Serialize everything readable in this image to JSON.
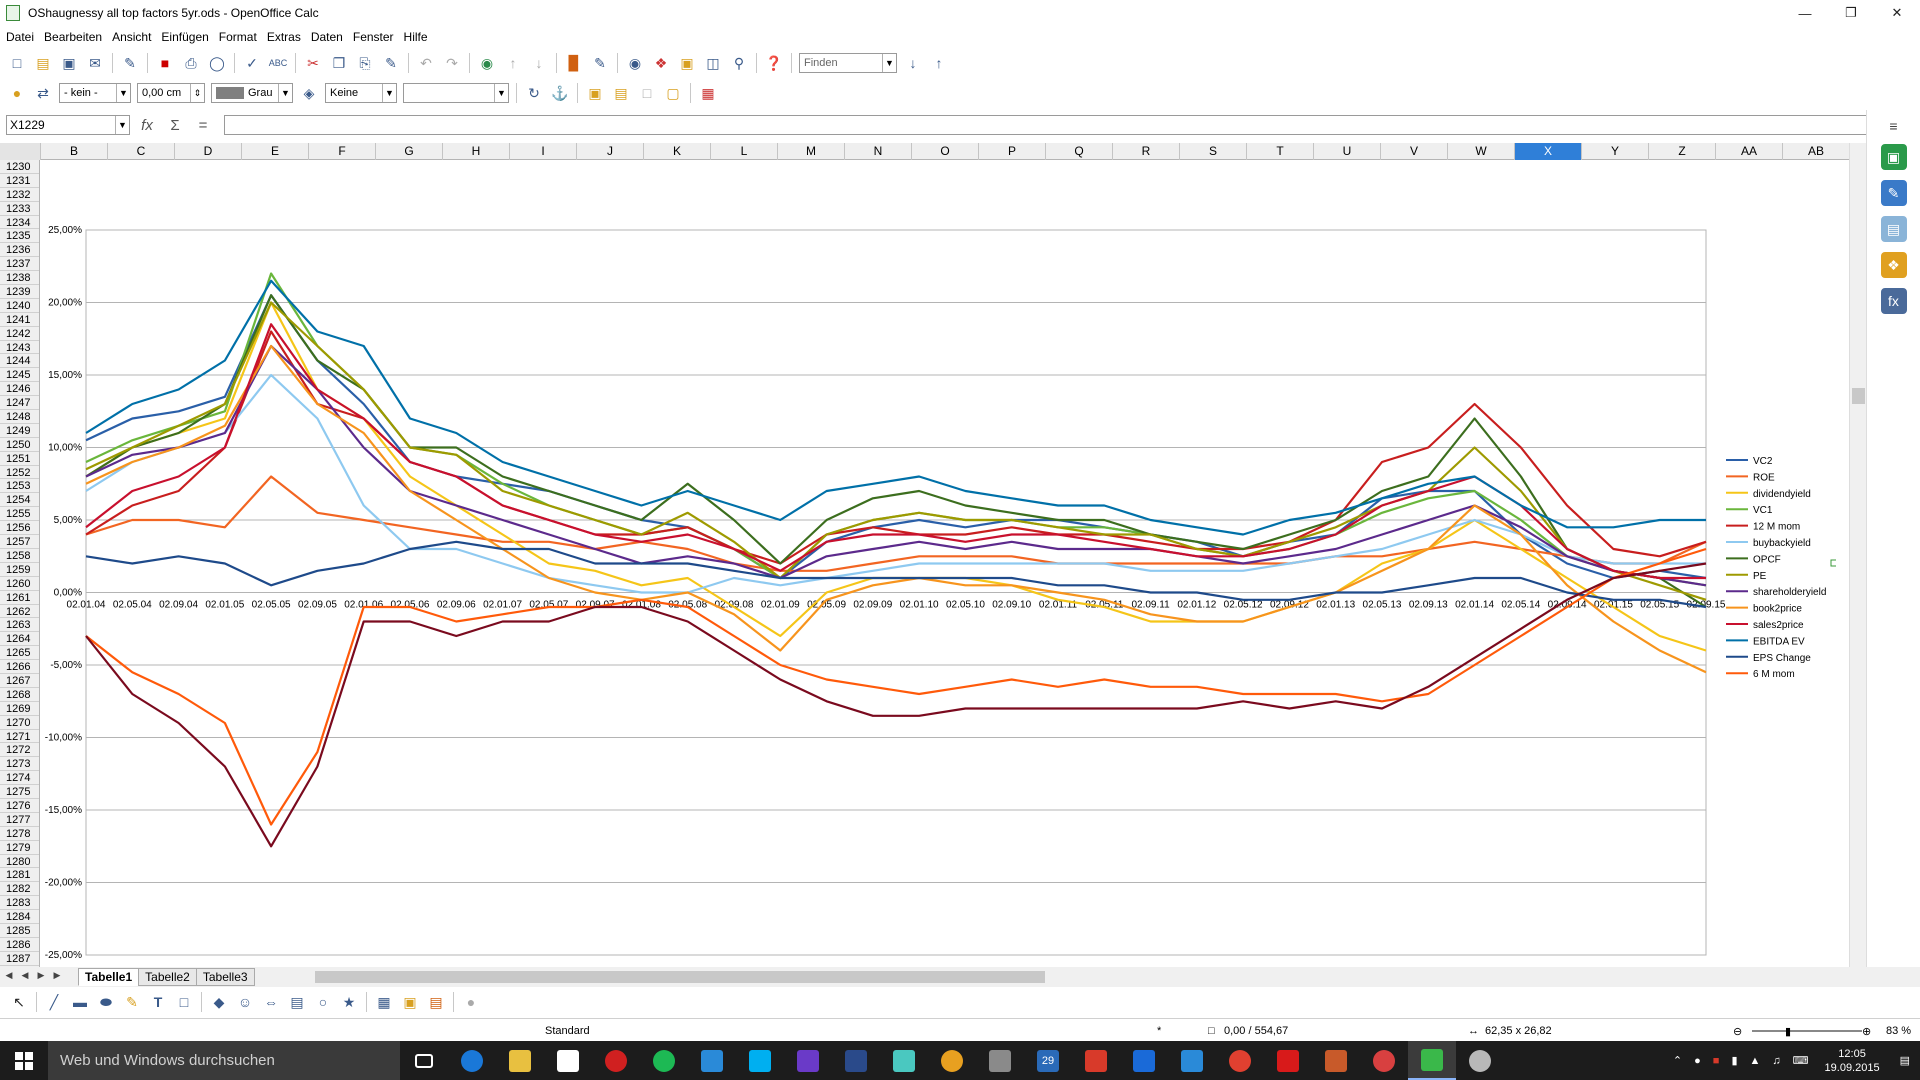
{
  "window": {
    "title": "OShaugnessy all top factors 5yr.ods - OpenOffice Calc"
  },
  "menu": [
    "Datei",
    "Bearbeiten",
    "Ansicht",
    "Einfügen",
    "Format",
    "Extras",
    "Daten",
    "Fenster",
    "Hilfe"
  ],
  "toolbar1": {
    "find_placeholder": "Finden"
  },
  "toolbar2": {
    "line_style": "- kein -",
    "line_width": "0,00 cm",
    "line_color": "Grau",
    "area_style": "Keine",
    "area_fill": ""
  },
  "formula": {
    "cell_ref": "X1229",
    "content": ""
  },
  "columns": [
    "B",
    "C",
    "D",
    "E",
    "F",
    "G",
    "H",
    "I",
    "J",
    "K",
    "L",
    "M",
    "N",
    "O",
    "P",
    "Q",
    "R",
    "S",
    "T",
    "U",
    "V",
    "W",
    "X",
    "Y",
    "Z",
    "AA",
    "AB"
  ],
  "selected_column": "X",
  "rows": [
    "1230",
    "1231",
    "1232",
    "1233",
    "1234",
    "1235",
    "1236",
    "1237",
    "1238",
    "1239",
    "1240",
    "1241",
    "1242",
    "1243",
    "1244",
    "1245",
    "1246",
    "1247",
    "1248",
    "1249",
    "1250",
    "1251",
    "1252",
    "1253",
    "1254",
    "1255",
    "1256",
    "1257",
    "1258",
    "1259",
    "1260",
    "1261",
    "1262",
    "1263",
    "1264",
    "1265",
    "1266",
    "1267",
    "1268",
    "1269",
    "1270",
    "1271",
    "1272",
    "1273",
    "1274",
    "1275",
    "1276",
    "1277",
    "1278",
    "1279",
    "1280",
    "1281",
    "1282",
    "1283",
    "1284",
    "1285",
    "1286",
    "1287"
  ],
  "sheet_tabs": [
    "Tabelle1",
    "Tabelle2",
    "Tabelle3"
  ],
  "active_tab": "Tabelle1",
  "status": {
    "style": "Standard",
    "mode": "*",
    "position": "0,00 / 554,67",
    "size": "62,35 x 26,82",
    "zoom": "83 %"
  },
  "taskbar": {
    "search_placeholder": "Web und Windows durchsuchen",
    "time": "12:05",
    "date": "19.09.2015",
    "calendar_day": "29"
  },
  "colors": {
    "selection": "#2f7fd8",
    "taskbar": "#1c1c1c"
  },
  "chart_data": {
    "type": "line",
    "title": "",
    "xlabel": "",
    "ylabel": "",
    "ylim": [
      -0.25,
      0.25
    ],
    "yticks": [
      "25,00%",
      "20,00%",
      "15,00%",
      "10,00%",
      "5,00%",
      "0,00%",
      "-5,00%",
      "-10,00%",
      "-15,00%",
      "-20,00%",
      "-25,00%"
    ],
    "grid": true,
    "legend_position": "right",
    "x": [
      "02.01.04",
      "02.05.04",
      "02.09.04",
      "02.01.05",
      "02.05.05",
      "02.09.05",
      "02.01.06",
      "02.05.06",
      "02.09.06",
      "02.01.07",
      "02.05.07",
      "02.09.07",
      "02.01.08",
      "02.05.08",
      "02.09.08",
      "02.01.09",
      "02.05.09",
      "02.09.09",
      "02.01.10",
      "02.05.10",
      "02.09.10",
      "02.01.11",
      "02.05.11",
      "02.09.11",
      "02.01.12",
      "02.05.12",
      "02.09.12",
      "02.01.13",
      "02.05.13",
      "02.09.13",
      "02.01.14",
      "02.05.14",
      "02.09.14",
      "02.01.15",
      "02.05.15",
      "02.09.15"
    ],
    "series": [
      {
        "name": "VC2",
        "color": "#2a5fa8",
        "values": [
          0.105,
          0.12,
          0.125,
          0.135,
          0.205,
          0.16,
          0.13,
          0.09,
          0.08,
          0.075,
          0.07,
          0.06,
          0.05,
          0.045,
          0.03,
          0.01,
          0.035,
          0.045,
          0.05,
          0.045,
          0.05,
          0.05,
          0.045,
          0.04,
          0.035,
          0.025,
          0.035,
          0.04,
          0.065,
          0.07,
          0.07,
          0.04,
          0.02,
          0.01,
          0.015,
          0.01
        ]
      },
      {
        "name": "ROE",
        "color": "#f26522",
        "values": [
          0.04,
          0.05,
          0.05,
          0.045,
          0.08,
          0.055,
          0.05,
          0.045,
          0.04,
          0.035,
          0.035,
          0.03,
          0.035,
          0.03,
          0.02,
          0.015,
          0.015,
          0.02,
          0.025,
          0.025,
          0.025,
          0.02,
          0.02,
          0.02,
          0.02,
          0.02,
          0.02,
          0.025,
          0.025,
          0.03,
          0.035,
          0.03,
          0.025,
          0.02,
          0.02,
          0.035
        ]
      },
      {
        "name": "dividendyield",
        "color": "#f5c518",
        "values": [
          0.08,
          0.1,
          0.11,
          0.12,
          0.2,
          0.14,
          0.12,
          0.08,
          0.06,
          0.04,
          0.02,
          0.015,
          0.005,
          0.01,
          -0.01,
          -0.03,
          0.0,
          0.01,
          0.01,
          0.01,
          0.005,
          -0.005,
          -0.01,
          -0.02,
          -0.02,
          -0.02,
          -0.01,
          0.0,
          0.02,
          0.03,
          0.05,
          0.03,
          0.01,
          -0.01,
          -0.03,
          -0.04
        ]
      },
      {
        "name": "VC1",
        "color": "#6ab63c",
        "values": [
          0.09,
          0.105,
          0.115,
          0.125,
          0.22,
          0.17,
          0.14,
          0.1,
          0.095,
          0.075,
          0.06,
          0.05,
          0.04,
          0.045,
          0.03,
          0.01,
          0.04,
          0.05,
          0.055,
          0.05,
          0.05,
          0.045,
          0.045,
          0.04,
          0.03,
          0.025,
          0.03,
          0.04,
          0.055,
          0.065,
          0.07,
          0.05,
          0.025,
          0.015,
          0.01,
          0.005
        ]
      },
      {
        "name": "12 M mom",
        "color": "#c81e1e",
        "values": [
          0.04,
          0.06,
          0.07,
          0.1,
          0.18,
          0.13,
          0.12,
          0.09,
          0.08,
          0.06,
          0.05,
          0.04,
          0.04,
          0.045,
          0.03,
          0.02,
          0.04,
          0.045,
          0.04,
          0.04,
          0.045,
          0.04,
          0.04,
          0.035,
          0.03,
          0.03,
          0.035,
          0.05,
          0.09,
          0.1,
          0.13,
          0.1,
          0.06,
          0.03,
          0.025,
          0.035
        ]
      },
      {
        "name": "buybackyield",
        "color": "#8ec9f0",
        "values": [
          0.07,
          0.09,
          0.1,
          0.11,
          0.15,
          0.12,
          0.06,
          0.03,
          0.03,
          0.02,
          0.01,
          0.005,
          0.0,
          0.0,
          0.01,
          0.005,
          0.01,
          0.015,
          0.02,
          0.02,
          0.02,
          0.02,
          0.02,
          0.015,
          0.015,
          0.015,
          0.02,
          0.025,
          0.03,
          0.04,
          0.05,
          0.04,
          0.025,
          0.02,
          0.02,
          0.02
        ]
      },
      {
        "name": "OPCF",
        "color": "#3c6e1e",
        "values": [
          0.08,
          0.1,
          0.11,
          0.13,
          0.205,
          0.16,
          0.14,
          0.1,
          0.1,
          0.08,
          0.07,
          0.06,
          0.05,
          0.075,
          0.05,
          0.02,
          0.05,
          0.065,
          0.07,
          0.06,
          0.055,
          0.05,
          0.05,
          0.04,
          0.035,
          0.03,
          0.04,
          0.05,
          0.07,
          0.08,
          0.12,
          0.08,
          0.03,
          0.015,
          0.01,
          -0.01
        ]
      },
      {
        "name": "PE",
        "color": "#9e9a00",
        "values": [
          0.085,
          0.1,
          0.115,
          0.13,
          0.2,
          0.17,
          0.14,
          0.1,
          0.095,
          0.07,
          0.06,
          0.05,
          0.04,
          0.055,
          0.035,
          0.01,
          0.04,
          0.05,
          0.055,
          0.05,
          0.05,
          0.045,
          0.04,
          0.04,
          0.03,
          0.025,
          0.035,
          0.045,
          0.06,
          0.07,
          0.1,
          0.07,
          0.03,
          0.015,
          0.005,
          -0.005
        ]
      },
      {
        "name": "shareholderyield",
        "color": "#5c2a8c",
        "values": [
          0.08,
          0.095,
          0.1,
          0.11,
          0.17,
          0.14,
          0.1,
          0.07,
          0.06,
          0.05,
          0.04,
          0.03,
          0.02,
          0.025,
          0.02,
          0.01,
          0.025,
          0.03,
          0.035,
          0.03,
          0.035,
          0.03,
          0.03,
          0.03,
          0.025,
          0.02,
          0.025,
          0.03,
          0.04,
          0.05,
          0.06,
          0.045,
          0.025,
          0.015,
          0.01,
          0.005
        ]
      },
      {
        "name": "book2price",
        "color": "#f7941d",
        "values": [
          0.075,
          0.09,
          0.1,
          0.115,
          0.17,
          0.13,
          0.11,
          0.07,
          0.05,
          0.03,
          0.01,
          0.0,
          -0.005,
          0.0,
          -0.015,
          -0.04,
          -0.005,
          0.005,
          0.01,
          0.005,
          0.005,
          0.0,
          -0.005,
          -0.015,
          -0.02,
          -0.02,
          -0.01,
          0.0,
          0.015,
          0.03,
          0.06,
          0.04,
          0.005,
          -0.02,
          -0.04,
          -0.055
        ]
      },
      {
        "name": "sales2price",
        "color": "#c8102e",
        "values": [
          0.045,
          0.07,
          0.08,
          0.1,
          0.185,
          0.14,
          0.12,
          0.09,
          0.08,
          0.06,
          0.05,
          0.04,
          0.035,
          0.04,
          0.03,
          0.015,
          0.035,
          0.04,
          0.04,
          0.035,
          0.04,
          0.04,
          0.035,
          0.03,
          0.025,
          0.025,
          0.03,
          0.04,
          0.06,
          0.07,
          0.08,
          0.06,
          0.03,
          0.015,
          0.01,
          0.01
        ]
      },
      {
        "name": "EBITDA EV",
        "color": "#0070a8",
        "values": [
          0.11,
          0.13,
          0.14,
          0.16,
          0.215,
          0.18,
          0.17,
          0.12,
          0.11,
          0.09,
          0.08,
          0.07,
          0.06,
          0.07,
          0.06,
          0.05,
          0.07,
          0.075,
          0.08,
          0.07,
          0.065,
          0.06,
          0.06,
          0.05,
          0.045,
          0.04,
          0.05,
          0.055,
          0.065,
          0.075,
          0.08,
          0.06,
          0.045,
          0.045,
          0.05,
          0.05
        ]
      },
      {
        "name": "EPS Change",
        "color": "#1e4a8a",
        "values": [
          0.025,
          0.02,
          0.025,
          0.02,
          0.005,
          0.015,
          0.02,
          0.03,
          0.035,
          0.03,
          0.03,
          0.02,
          0.02,
          0.02,
          0.015,
          0.01,
          0.01,
          0.01,
          0.01,
          0.01,
          0.01,
          0.005,
          0.005,
          0.0,
          0.0,
          -0.005,
          -0.005,
          0.0,
          0.0,
          0.005,
          0.01,
          0.01,
          0.0,
          -0.005,
          -0.005,
          -0.01
        ]
      },
      {
        "name": "6 M mom",
        "color": "#ff5a0a",
        "values": [
          -0.03,
          -0.055,
          -0.07,
          -0.09,
          -0.16,
          -0.11,
          -0.01,
          -0.01,
          -0.02,
          -0.015,
          -0.01,
          -0.01,
          -0.005,
          -0.01,
          -0.03,
          -0.05,
          -0.06,
          -0.065,
          -0.07,
          -0.065,
          -0.06,
          -0.065,
          -0.06,
          -0.065,
          -0.065,
          -0.07,
          -0.07,
          -0.07,
          -0.075,
          -0.07,
          -0.05,
          -0.03,
          -0.01,
          0.01,
          0.02,
          0.03
        ]
      },
      {
        "name": "",
        "color": "#7a0a1e",
        "values": [
          -0.03,
          -0.07,
          -0.09,
          -0.12,
          -0.175,
          -0.12,
          -0.02,
          -0.02,
          -0.03,
          -0.02,
          -0.02,
          -0.01,
          -0.01,
          -0.02,
          -0.04,
          -0.06,
          -0.075,
          -0.085,
          -0.085,
          -0.08,
          -0.08,
          -0.08,
          -0.08,
          -0.08,
          -0.08,
          -0.075,
          -0.08,
          -0.075,
          -0.08,
          -0.065,
          -0.045,
          -0.025,
          -0.005,
          0.01,
          0.015,
          0.02
        ]
      }
    ]
  }
}
